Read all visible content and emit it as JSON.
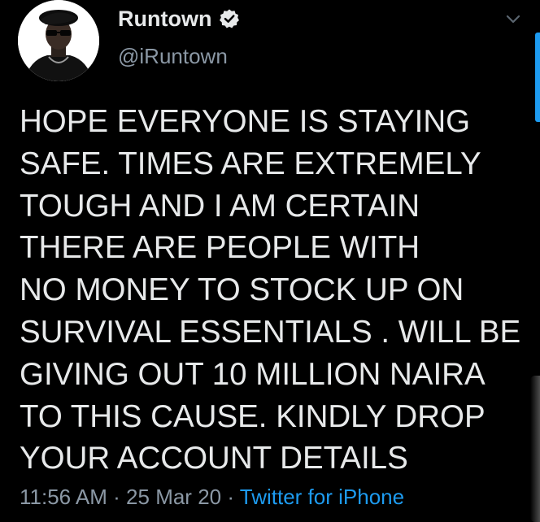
{
  "tweet": {
    "author": {
      "display_name": "Runtown",
      "handle": "@iRuntown",
      "verified": true
    },
    "text_lines": [
      "HOPE EVERYONE IS STAYING",
      "SAFE. TIMES ARE EXTREMELY",
      "TOUGH AND I AM CERTAIN",
      "THERE ARE PEOPLE WITH",
      "NO MONEY TO STOCK UP ON",
      "SURVIVAL ESSENTIALS . WILL BE",
      "GIVING OUT 10 MILLION NAIRA",
      "TO THIS CAUSE. KINDLY DROP",
      "YOUR ACCOUNT DETAILS"
    ],
    "meta": {
      "time": "11:56 AM",
      "separator": " · ",
      "date": "25 Mar 20",
      "source": "Twitter for iPhone"
    }
  },
  "icons": {
    "verified": "verified-badge-icon",
    "menu": "chevron-down-icon"
  },
  "colors": {
    "background": "#000000",
    "primary_text": "#e7e9ea",
    "secondary_text": "#8b98a5",
    "accent": "#1d9bf0"
  }
}
